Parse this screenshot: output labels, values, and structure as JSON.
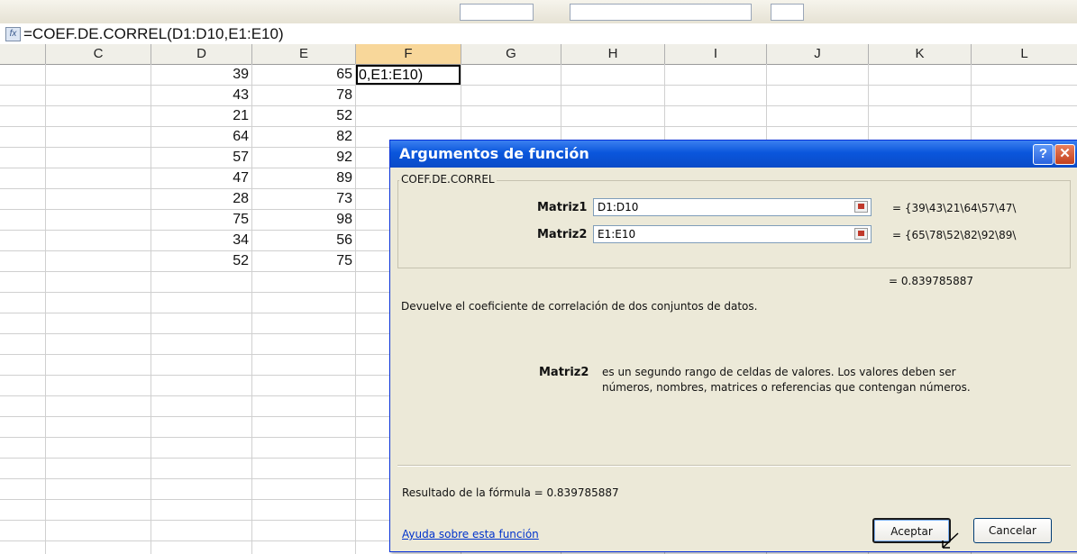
{
  "formula_bar": {
    "fx_symbol": "fx",
    "formula": "=COEF.DE.CORREL(D1:D10,E1:E10)"
  },
  "columns": [
    "C",
    "D",
    "E",
    "F",
    "G",
    "H",
    "I",
    "J",
    "K",
    "L"
  ],
  "active_column": "F",
  "sheet": {
    "d_values": [
      "39",
      "43",
      "21",
      "64",
      "57",
      "47",
      "28",
      "75",
      "34",
      "52"
    ],
    "e_values": [
      "65",
      "78",
      "52",
      "82",
      "92",
      "89",
      "73",
      "98",
      "56",
      "75"
    ],
    "edit_cell_text": "0,E1:E10)"
  },
  "dialog": {
    "title": "Argumentos de función",
    "help_glyph": "?",
    "close_glyph": "✕",
    "function_name": "COEF.DE.CORREL",
    "arg1": {
      "label": "Matriz1",
      "value": "D1:D10",
      "evaluated": "= {39\\43\\21\\64\\57\\47\\"
    },
    "arg2": {
      "label": "Matriz2",
      "value": "E1:E10",
      "evaluated": "= {65\\78\\52\\82\\92\\89\\"
    },
    "function_result": "= 0.839785887",
    "description": "Devuelve el coeficiente de correlación de dos conjuntos de datos.",
    "arg_help_name": "Matriz2",
    "arg_help_line1": "es un segundo rango de celdas de valores. Los valores deben ser",
    "arg_help_line2": "números, nombres, matrices o referencias que contengan números.",
    "formula_result": "Resultado de la fórmula =  0.839785887",
    "help_link": "Ayuda sobre esta función",
    "ok_label": "Aceptar",
    "cancel_label": "Cancelar"
  }
}
